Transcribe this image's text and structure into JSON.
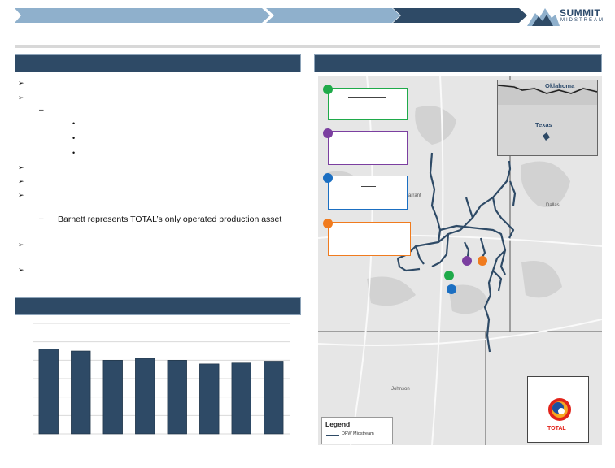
{
  "header": {
    "logo_main": "SUMMIT",
    "logo_sub": "MIDSTREAM"
  },
  "left": {
    "bullets": [
      {
        "type": "arrow"
      },
      {
        "type": "arrow"
      },
      {
        "type": "dash"
      },
      {
        "type": "dot"
      },
      {
        "type": "dot"
      },
      {
        "type": "dot"
      },
      {
        "type": "arrow"
      },
      {
        "type": "arrow"
      },
      {
        "type": "arrow"
      },
      {
        "type": "dash",
        "text": "Barnett represents TOTAL’s only operated production asset"
      },
      {
        "type": "arrow"
      },
      {
        "type": "arrow"
      }
    ]
  },
  "chart_data": {
    "type": "bar",
    "values": [
      4.6,
      4.5,
      4.0,
      4.1,
      4.0,
      3.8,
      3.85,
      3.95
    ],
    "ylim": [
      0,
      6
    ],
    "grid": true,
    "color": "#2e4a66"
  },
  "map": {
    "labels": {
      "tarrant": "Tarrant",
      "dallas": "Dallas",
      "johnson": "Johnson"
    },
    "inset": {
      "oklahoma": "Oklahoma",
      "texas": "Texas"
    },
    "legend": {
      "title": "Legend",
      "item": "DFW Midstream"
    },
    "total_logo_text": "TOTAL",
    "callout_colors": {
      "green": "#1faa4a",
      "purple": "#7b3fa0",
      "blue": "#1b6fc2",
      "orange": "#f07b1e"
    },
    "pipeline_color": "#2e4a66"
  }
}
